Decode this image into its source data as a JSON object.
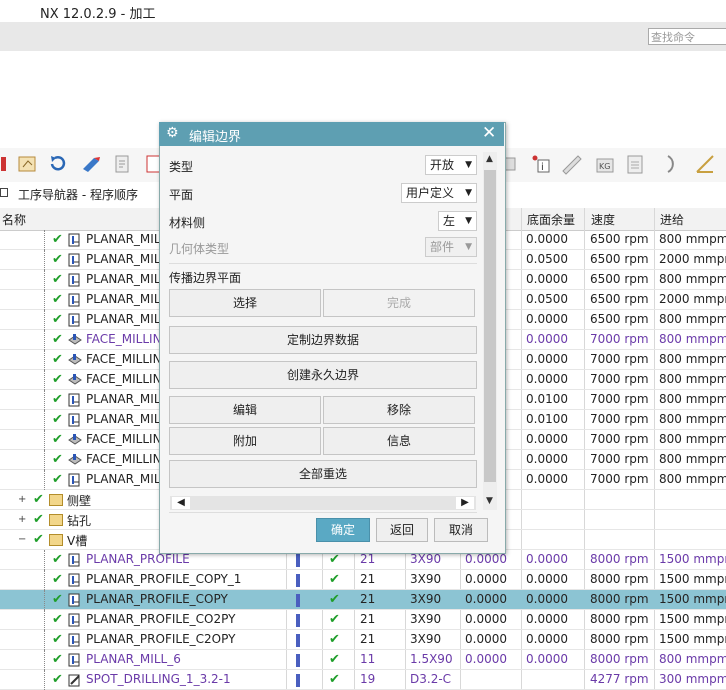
{
  "app": {
    "title": "NX 12.0.2.9 - 加工"
  },
  "search": {
    "placeholder": "查找命令"
  },
  "navigator": {
    "title": "工序导航器 - 程序顺序"
  },
  "columns": {
    "name": "名称",
    "floor_stock": "底面余量",
    "speed": "速度",
    "feed": "进给"
  },
  "rows": [
    {
      "name": "PLANAR_MIL",
      "floor": "0.0000",
      "speed": "6500 rpm",
      "feed": "800 mmpm",
      "purple": false,
      "icon": "planar-mill-icon"
    },
    {
      "name": "PLANAR_MIL",
      "floor": "0.0500",
      "speed": "6500 rpm",
      "feed": "2000 mmpm",
      "purple": false,
      "icon": "planar-mill-icon"
    },
    {
      "name": "PLANAR_MIL",
      "floor": "0.0000",
      "speed": "6500 rpm",
      "feed": "800 mmpm",
      "purple": false,
      "icon": "planar-mill-icon"
    },
    {
      "name": "PLANAR_MIL",
      "floor": "0.0500",
      "speed": "6500 rpm",
      "feed": "2000 mmpm",
      "purple": false,
      "icon": "planar-mill-icon"
    },
    {
      "name": "PLANAR_MIL",
      "floor": "0.0000",
      "speed": "6500 rpm",
      "feed": "800 mmpm",
      "purple": false,
      "icon": "planar-mill-icon"
    },
    {
      "name": "FACE_MILLIN",
      "floor": "0.0000",
      "speed": "7000 rpm",
      "feed": "800 mmpm",
      "purple": true,
      "icon": "face-milling-icon"
    },
    {
      "name": "FACE_MILLIN",
      "floor": "0.0000",
      "speed": "7000 rpm",
      "feed": "800 mmpm",
      "purple": false,
      "icon": "face-milling-icon"
    },
    {
      "name": "FACE_MILLIN",
      "floor": "0.0000",
      "speed": "7000 rpm",
      "feed": "800 mmpm",
      "purple": false,
      "icon": "face-milling-icon"
    },
    {
      "name": "PLANAR_MIL",
      "floor": "0.0100",
      "speed": "7000 rpm",
      "feed": "800 mmpm",
      "purple": false,
      "icon": "planar-mill-icon"
    },
    {
      "name": "PLANAR_MIL",
      "floor": "0.0100",
      "speed": "7000 rpm",
      "feed": "800 mmpm",
      "purple": false,
      "icon": "planar-mill-icon"
    },
    {
      "name": "FACE_MILLIN",
      "floor": "0.0000",
      "speed": "7000 rpm",
      "feed": "800 mmpm",
      "purple": false,
      "icon": "face-milling-icon"
    },
    {
      "name": "FACE_MILLIN",
      "floor": "0.0000",
      "speed": "7000 rpm",
      "feed": "800 mmpm",
      "purple": false,
      "icon": "face-milling-icon"
    },
    {
      "name": "PLANAR_MIL",
      "floor": "0.0000",
      "speed": "7000 rpm",
      "feed": "800 mmpm",
      "purple": false,
      "icon": "planar-mill-icon"
    }
  ],
  "groups": [
    {
      "name": "侧壁",
      "expanded": false
    },
    {
      "name": "钻孔",
      "expanded": false
    },
    {
      "name": "V槽",
      "expanded": true
    }
  ],
  "vrows": [
    {
      "name": "PLANAR_PROFILE",
      "tool": "21",
      "path": "3X90",
      "wall": "0.0000",
      "floor": "0.0000",
      "speed": "8000 rpm",
      "feed": "1500 mmpm",
      "purple": true,
      "selected": false
    },
    {
      "name": "PLANAR_PROFILE_COPY_1",
      "tool": "21",
      "path": "3X90",
      "wall": "0.0000",
      "floor": "0.0000",
      "speed": "8000 rpm",
      "feed": "1500 mmpm",
      "purple": false,
      "selected": false
    },
    {
      "name": "PLANAR_PROFILE_COPY",
      "tool": "21",
      "path": "3X90",
      "wall": "0.0000",
      "floor": "0.0000",
      "speed": "8000 rpm",
      "feed": "1500 mmpm",
      "purple": false,
      "selected": true
    },
    {
      "name": "PLANAR_PROFILE_CO2PY",
      "tool": "21",
      "path": "3X90",
      "wall": "0.0000",
      "floor": "0.0000",
      "speed": "8000 rpm",
      "feed": "1500 mmpm",
      "purple": false,
      "selected": false
    },
    {
      "name": "PLANAR_PROFILE_C2OPY",
      "tool": "21",
      "path": "3X90",
      "wall": "0.0000",
      "floor": "0.0000",
      "speed": "8000 rpm",
      "feed": "1500 mmpm",
      "purple": false,
      "selected": false
    },
    {
      "name": "PLANAR_MILL_6",
      "tool": "11",
      "path": "1.5X90",
      "wall": "0.0000",
      "floor": "0.0000",
      "speed": "8000 rpm",
      "feed": "800 mmpm",
      "purple": true,
      "selected": false
    },
    {
      "name": "SPOT_DRILLING_1_3.2-1",
      "tool": "19",
      "path": "D3.2-C",
      "wall": "",
      "floor": "",
      "speed": "4277 rpm",
      "feed": "300 mmpm",
      "purple": true,
      "selected": false
    }
  ],
  "dialog": {
    "title": "编辑边界",
    "type_label": "类型",
    "type_value": "开放",
    "plane_label": "平面",
    "plane_value": "用户定义",
    "material_label": "材料侧",
    "material_value": "左",
    "geom_label": "几何体类型",
    "geom_value": "部件",
    "propagate_label": "传播边界平面",
    "select_btn": "选择",
    "done_btn": "完成",
    "custom_btn": "定制边界数据",
    "permanent_btn": "创建永久边界",
    "edit_btn": "编辑",
    "remove_btn": "移除",
    "append_btn": "附加",
    "info_btn": "信息",
    "reselect_btn": "全部重选",
    "ok_btn": "确定",
    "back_btn": "返回",
    "cancel_btn": "取消"
  },
  "colors": {
    "accent": "#5e9fb2",
    "selected_row": "#8cc4d3",
    "purple_text": "#6a3aa8",
    "check": "#1f9e2a"
  }
}
